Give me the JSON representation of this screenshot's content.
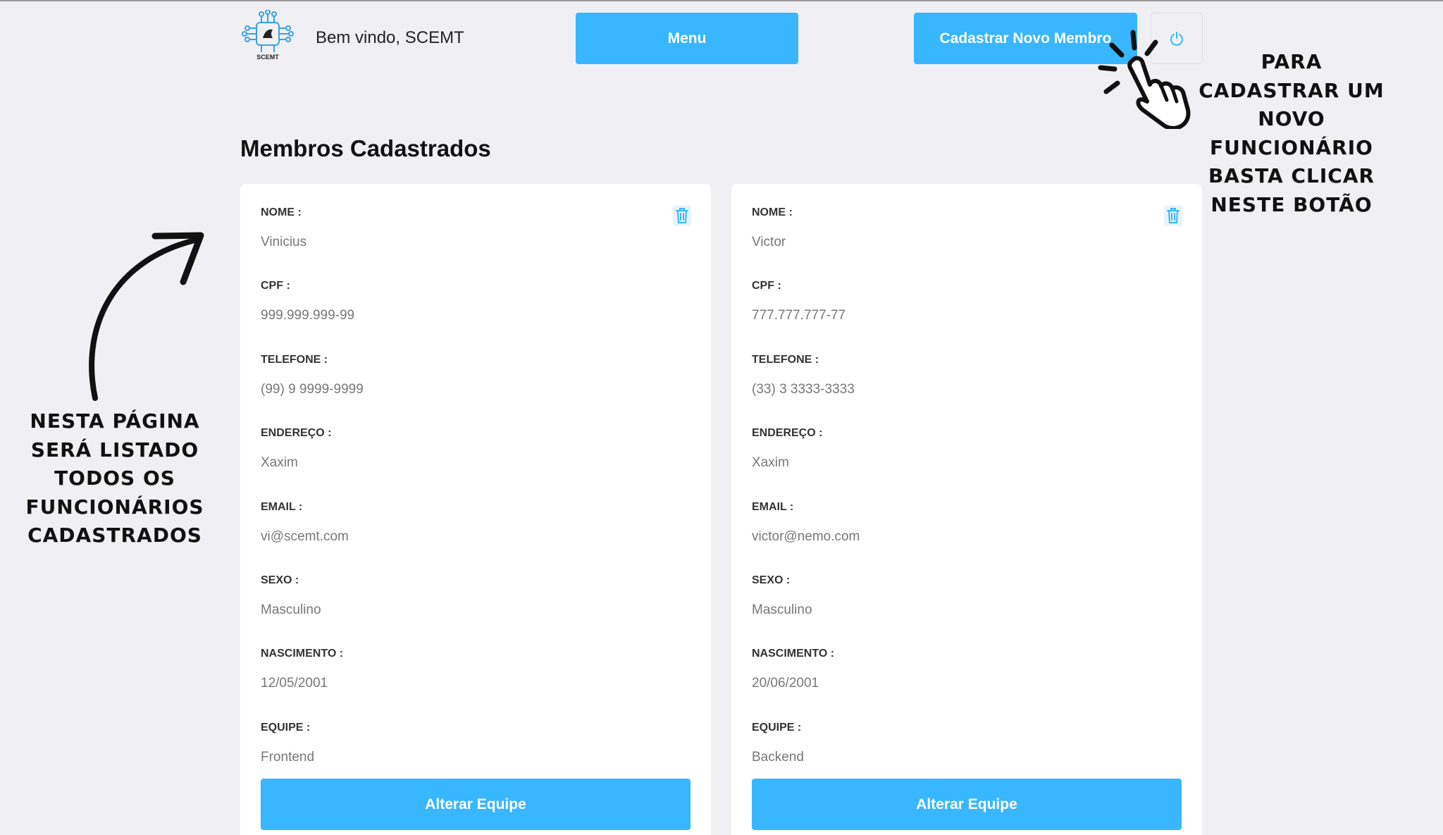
{
  "header": {
    "logo_text": "SCEMT",
    "welcome": "Bem vindo, SCEMT",
    "menu_label": "Menu",
    "new_member_label": "Cadastrar Novo Membro",
    "power_icon": "power-icon"
  },
  "page": {
    "title": "Membros Cadastrados"
  },
  "labels": {
    "nome": "NOME :",
    "cpf": "CPF :",
    "telefone": "TELEFONE :",
    "endereco": "ENDEREÇO :",
    "email": "EMAIL :",
    "sexo": "SEXO :",
    "nascimento": "NASCIMENTO :",
    "equipe": "EQUIPE :"
  },
  "members": [
    {
      "nome": "Vinicius",
      "cpf": "999.999.999-99",
      "telefone": "(99) 9 9999-9999",
      "endereco": "Xaxim",
      "email": "vi@scemt.com",
      "sexo": "Masculino",
      "nascimento": "12/05/2001",
      "equipe": "Frontend",
      "button_label": "Alterar Equipe"
    },
    {
      "nome": "Victor",
      "cpf": "777.777.777-77",
      "telefone": "(33) 3 3333-3333",
      "endereco": "Xaxim",
      "email": "victor@nemo.com",
      "sexo": "Masculino",
      "nascimento": "20/06/2001",
      "equipe": "Backend",
      "button_label": "Alterar Equipe"
    }
  ],
  "annotations": {
    "left": [
      "NESTA PÁGINA",
      "SERÁ LISTADO",
      "TODOS OS",
      "FUNCIONÁRIOS",
      "CADASTRADOS"
    ],
    "right": [
      "PARA",
      "CADASTRAR UM",
      "NOVO",
      "FUNCIONÁRIO",
      "BASTA CLICAR",
      "NESTE BOTÃO"
    ]
  },
  "colors": {
    "accent": "#38b6ff",
    "background": "#f0f0f4",
    "card": "#ffffff"
  }
}
